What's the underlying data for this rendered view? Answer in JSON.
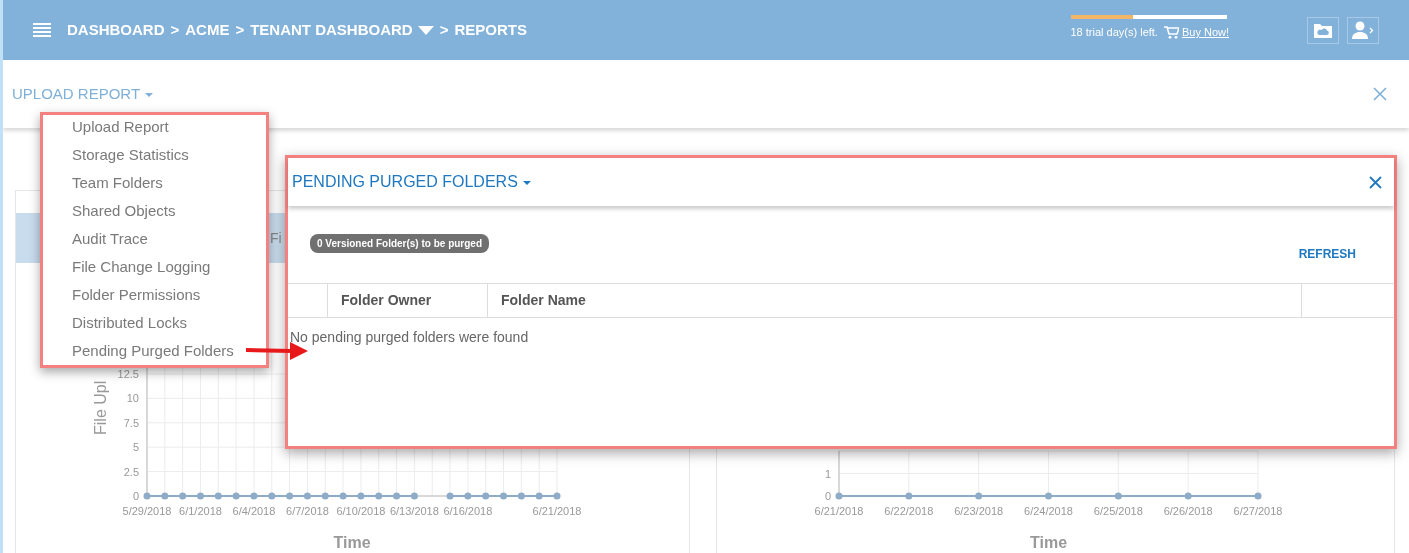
{
  "header": {
    "breadcrumbs": [
      {
        "kind": "crumb",
        "label": "DASHBOARD",
        "dropdown": false
      },
      {
        "kind": "separator",
        "label": ">"
      },
      {
        "kind": "crumb",
        "label": "ACME",
        "dropdown": false
      },
      {
        "kind": "separator",
        "label": ">"
      },
      {
        "kind": "crumb",
        "label": "TENANT DASHBOARD",
        "dropdown": true
      },
      {
        "kind": "separator",
        "label": ">"
      },
      {
        "kind": "crumb",
        "label": "REPORTS",
        "dropdown": false
      }
    ],
    "trial": {
      "level": 0.4,
      "text": "18 trial day(s) left.",
      "link": "Buy Now!"
    }
  },
  "report_bar": {
    "title": "UPLOAD REPORT"
  },
  "report_menu": {
    "items": [
      {
        "label": "Upload Report"
      },
      {
        "label": "Storage Statistics"
      },
      {
        "label": "Team Folders"
      },
      {
        "label": "Shared Objects"
      },
      {
        "label": "Audit Trace"
      },
      {
        "label": "File Change Logging"
      },
      {
        "label": "Folder Permissions"
      },
      {
        "label": "Distributed Locks"
      },
      {
        "label": "Pending Purged Folders"
      }
    ]
  },
  "cards": [
    {
      "tab_label": "Fi",
      "chart_data": {
        "type": "line",
        "xlabel": "Time",
        "ylabel": "File Upl",
        "grid": true,
        "categories": [
          "5/29/2018",
          null,
          null,
          "6/1/2018",
          null,
          null,
          "6/4/2018",
          null,
          null,
          "6/7/2018",
          null,
          null,
          "6/10/2018",
          null,
          null,
          "6/13/2018",
          null,
          null,
          "6/16/2018",
          null,
          null,
          null,
          null,
          "6/21/2018"
        ],
        "series": [
          {
            "color": "#8eabc7",
            "marker": "circle",
            "values": [
              0,
              0,
              0,
              0,
              0,
              0,
              0,
              0,
              0,
              0,
              0,
              0,
              0,
              0,
              0,
              0,
              null,
              0,
              0,
              0,
              0,
              0,
              0,
              0
            ]
          }
        ],
        "yticks": [
          0,
          2.5,
          5,
          7.5,
          10,
          12.5
        ],
        "ylim": [
          0,
          15
        ]
      }
    },
    {
      "chart_data": {
        "type": "line",
        "xlabel": "Time",
        "grid": true,
        "categories": [
          "6/21/2018",
          "6/22/2018",
          "6/23/2018",
          "6/24/2018",
          "6/25/2018",
          "6/26/2018",
          "6/27/2018"
        ],
        "series": [
          {
            "color": "#8eabc7",
            "marker": "circle",
            "values": [
              0,
              0,
              0,
              0,
              0,
              0,
              0
            ]
          }
        ],
        "yticks": [
          0,
          1
        ],
        "ylim": [
          0,
          2
        ]
      }
    }
  ],
  "modal": {
    "title": "PENDING PURGED FOLDERS",
    "badge": "0 Versioned Folder(s) to be purged",
    "refresh": "REFRESH",
    "columns": [
      {
        "label": "Folder Owner"
      },
      {
        "label": "Folder Name"
      }
    ],
    "empty_message": "No pending purged folders were found"
  }
}
